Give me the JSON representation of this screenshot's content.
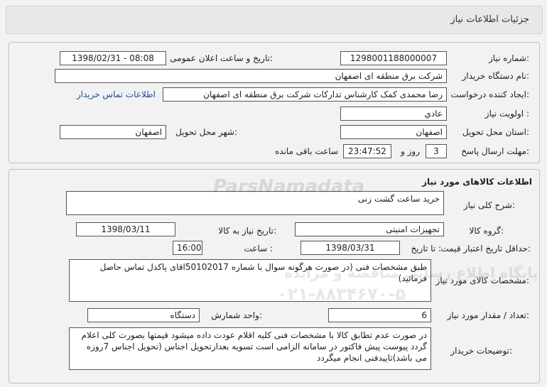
{
  "header": {
    "title": "جزئیات اطلاعات نیاز"
  },
  "info": {
    "need_number_label": "شماره نیاز:",
    "need_number": "1298001188000007",
    "announce_label": "تاریخ و ساعت اعلان عمومی:",
    "announce_value": "1398/02/31 - 08:08",
    "buyer_org_label": "نام دستگاه خریدار:",
    "buyer_org": "شرکت برق منطقه ای اصفهان",
    "requester_label": "ایجاد کننده درخواست:",
    "requester": "رضا  محمدی کمک کارشناس تدارکات شرکت برق منطقه ای اصفهان",
    "contact_link": "اطلاعات تماس خریدار",
    "priority_label": "اولویت نیاز :",
    "priority": "عادي",
    "province_label": "استان محل تحویل:",
    "province": "اصفهان",
    "city_label": "شهر محل تحویل:",
    "city": "اصفهان",
    "deadline_label": "مهلت ارسال پاسخ:",
    "days": "3",
    "days_unit": "روز و",
    "time_left": "23:47:52",
    "time_left_suffix": "ساعت باقی مانده"
  },
  "goods": {
    "section_title": "اطلاعات کالاهای مورد نیاز",
    "summary_label": "شرح کلی نیاز:",
    "summary": "خرید ساعت گشت زنی",
    "group_label": "گروه کالا:",
    "group": "تجهیزات امنیتی",
    "need_date_label": "تاریخ نیاز به کالا:",
    "need_date": "1398/03/11",
    "validity_label": "حداقل تاریخ اعتبار قیمت:",
    "to_date_label": "تا تاریخ :",
    "validity_date": "1398/03/31",
    "hour_label": "ساعت :",
    "validity_hour": "16:00",
    "spec_label": "مشخصات کالای مورد نیاز:",
    "spec": "طبق مشخصات فنی (در صورت هرگونه سوال با شماره 50102017اقای پاکدل تماس حاصل فرمائید)",
    "qty_label": "تعداد / مقدار مورد نیاز:",
    "qty": "6",
    "unit_label": "واحد شمارش:",
    "unit": "دستگاه",
    "notes_label": "توضیحات خریدار:",
    "notes": "در صورت عدم تطابق کالا با مشخصات فنی کلیه اقلام عودت داده میشود قیمتها بصورت کلی اعلام گردد پیوست پیش فاکتور در سامانه الزامی است تسویه بعدازتحویل اجناس (تحویل اجناس 7روزه می باشد)تاییدفنی انجام میگردد"
  },
  "watermark": {
    "brand": "ParsNamadata",
    "line1": "پایگاه اطلاع رسانی مناقصه و مزایده",
    "phone": "۰۲۱-۸۸۳۴۶۷۰-۵"
  }
}
